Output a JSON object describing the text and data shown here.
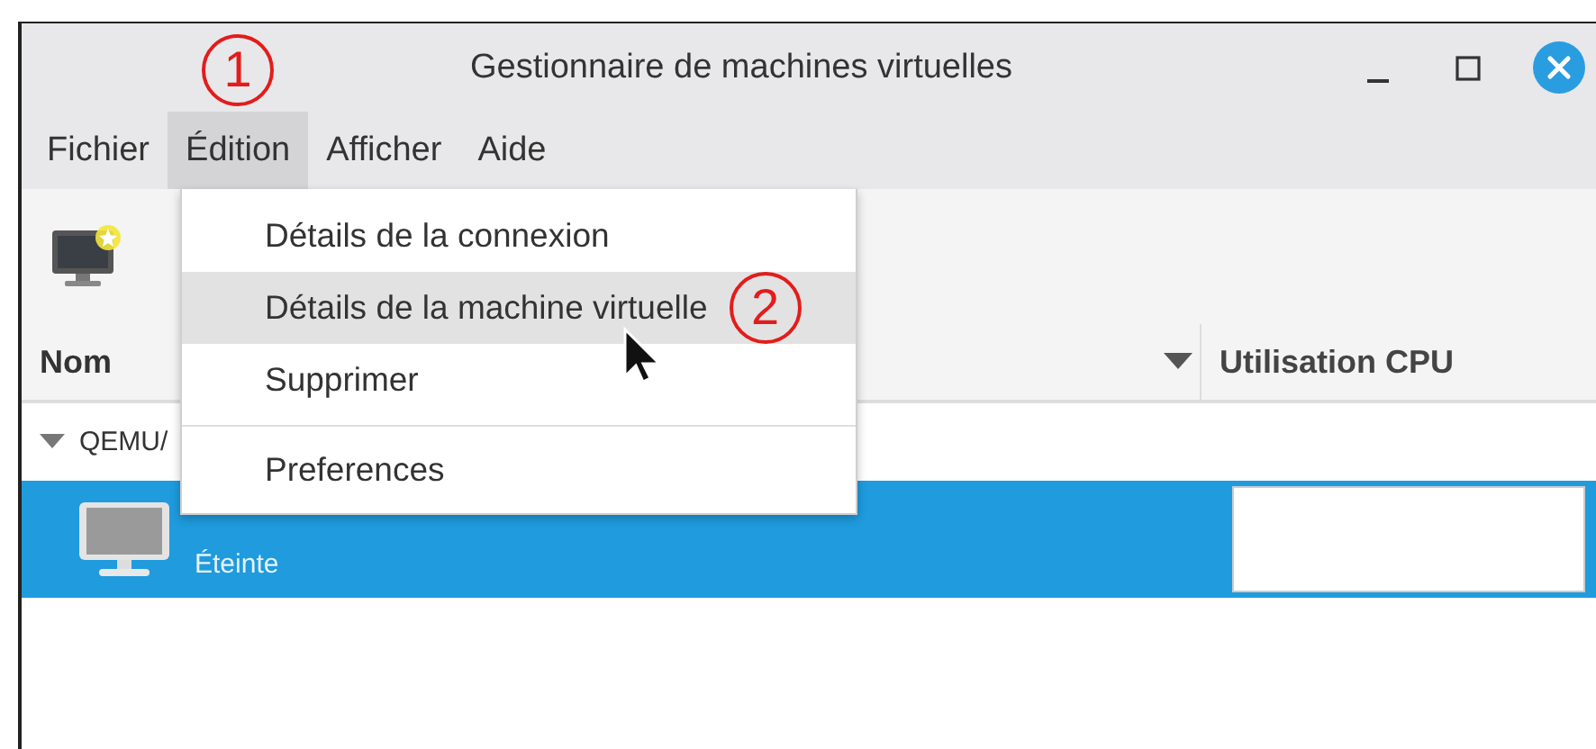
{
  "window": {
    "title": "Gestionnaire de machines virtuelles"
  },
  "menubar": [
    {
      "label": "Fichier",
      "selected": false
    },
    {
      "label": "Édition",
      "selected": true,
      "annotation": "1"
    },
    {
      "label": "Afficher",
      "selected": false
    },
    {
      "label": "Aide",
      "selected": false
    }
  ],
  "table": {
    "columns": [
      {
        "label": "Nom",
        "sorted": true
      },
      {
        "label": "Utilisation CPU",
        "sorted": false
      }
    ],
    "groups": [
      {
        "label": "QEMU/",
        "expanded": true,
        "rows": [
          {
            "status": "Éteinte",
            "selected": true
          }
        ]
      }
    ]
  },
  "menu": {
    "items": [
      {
        "kind": "item",
        "label": "Détails de la connexion",
        "selected": false
      },
      {
        "kind": "item",
        "label": "Détails de la machine virtuelle",
        "selected": true,
        "annotation": "2"
      },
      {
        "kind": "item",
        "label": "Supprimer",
        "selected": false
      },
      {
        "kind": "separator"
      },
      {
        "kind": "item",
        "label": "Preferences",
        "selected": false
      }
    ]
  }
}
